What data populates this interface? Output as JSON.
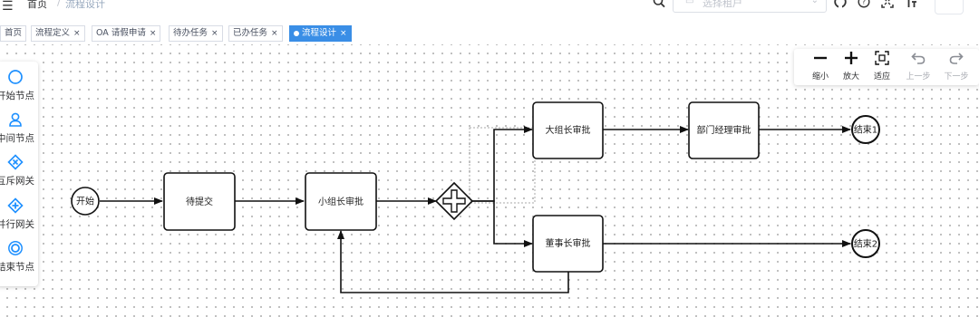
{
  "header": {
    "breadcrumb_home": "首页",
    "breadcrumb_sep": "/",
    "breadcrumb_current": "流程设计",
    "tenant_placeholder": "选择租户"
  },
  "tabs": [
    {
      "label": "首页",
      "closable": false,
      "active": false
    },
    {
      "label": "流程定义",
      "closable": true,
      "active": false
    },
    {
      "label": "OA 请假申请",
      "closable": true,
      "active": false
    },
    {
      "label": "待办任务",
      "closable": true,
      "active": false
    },
    {
      "label": "已办任务",
      "closable": true,
      "active": false
    },
    {
      "label": "流程设计",
      "closable": true,
      "active": true
    }
  ],
  "tab_close_glyph": "×",
  "palette": [
    {
      "label": "开始节点",
      "icon": "start-event-icon"
    },
    {
      "label": "中间节点",
      "icon": "user-task-icon"
    },
    {
      "label": "互斥网关",
      "icon": "exclusive-gateway-icon"
    },
    {
      "label": "并行网关",
      "icon": "parallel-gateway-icon"
    },
    {
      "label": "结束节点",
      "icon": "end-event-icon"
    }
  ],
  "toolbar": [
    {
      "label": "缩小",
      "icon": "zoom-out-icon",
      "enabled": true
    },
    {
      "label": "放大",
      "icon": "zoom-in-icon",
      "enabled": true
    },
    {
      "label": "适应",
      "icon": "fit-icon",
      "enabled": true
    },
    {
      "label": "上一步",
      "icon": "undo-icon",
      "enabled": false
    },
    {
      "label": "下一步",
      "icon": "redo-icon",
      "enabled": false
    }
  ],
  "diagram": {
    "start": "开始",
    "task_submit": "待提交",
    "task_group_leader": "小组长审批",
    "task_big_group_leader": "大组长审批",
    "task_dept_manager": "部门经理审批",
    "task_chairman": "董事长审批",
    "end1": "结束1",
    "end2": "结束2"
  },
  "colors": {
    "accent": "#3a8ee6",
    "palette_icon": "#1e90ff"
  }
}
